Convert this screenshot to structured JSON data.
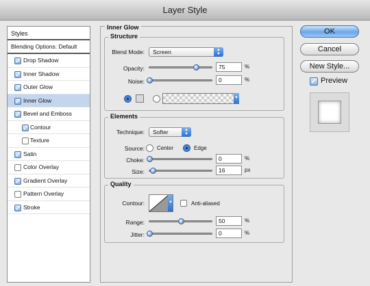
{
  "window": {
    "title": "Layer Style"
  },
  "styles_list": {
    "header": "Styles",
    "blending": "Blending Options: Default",
    "items": [
      {
        "label": "Drop Shadow",
        "checked": true
      },
      {
        "label": "Inner Shadow",
        "checked": true
      },
      {
        "label": "Outer Glow",
        "checked": true
      },
      {
        "label": "Inner Glow",
        "checked": true,
        "active": true
      },
      {
        "label": "Bevel and Emboss",
        "checked": true
      },
      {
        "label": "Contour",
        "checked": true,
        "sub": true
      },
      {
        "label": "Texture",
        "checked": false,
        "sub": true
      },
      {
        "label": "Satin",
        "checked": true
      },
      {
        "label": "Color Overlay",
        "checked": false
      },
      {
        "label": "Gradient Overlay",
        "checked": true
      },
      {
        "label": "Pattern Overlay",
        "checked": false
      },
      {
        "label": "Stroke",
        "checked": true
      }
    ]
  },
  "inner_glow": {
    "title": "Inner Glow",
    "structure": {
      "title": "Structure",
      "blend_mode_label": "Blend Mode:",
      "blend_mode": "Screen",
      "opacity_label": "Opacity:",
      "opacity": "75",
      "opacity_unit": "%",
      "opacity_level": 0.75,
      "noise_label": "Noise:",
      "noise": "0",
      "noise_unit": "%",
      "noise_level": 0.0,
      "fill_mode": "color"
    },
    "elements": {
      "title": "Elements",
      "technique_label": "Technique:",
      "technique": "Softer",
      "source_label": "Source:",
      "source_center": "Center",
      "source_edge": "Edge",
      "source_selected": "Edge",
      "choke_label": "Choke:",
      "choke": "0",
      "choke_unit": "%",
      "choke_level": 0.0,
      "size_label": "Size:",
      "size": "16",
      "size_unit": "px",
      "size_level": 0.06
    },
    "quality": {
      "title": "Quality",
      "contour_label": "Contour:",
      "anti_aliased_label": "Anti-aliased",
      "anti_aliased": false,
      "range_label": "Range:",
      "range": "50",
      "range_unit": "%",
      "range_level": 0.5,
      "jitter_label": "Jitter:",
      "jitter": "0",
      "jitter_unit": "%",
      "jitter_level": 0.0
    }
  },
  "buttons": {
    "ok": "OK",
    "cancel": "Cancel",
    "new_style": "New Style...",
    "preview": "Preview",
    "preview_checked": true
  },
  "colors": {
    "accent": "#2e6fc9",
    "selected_row": "#c3d6ee"
  }
}
